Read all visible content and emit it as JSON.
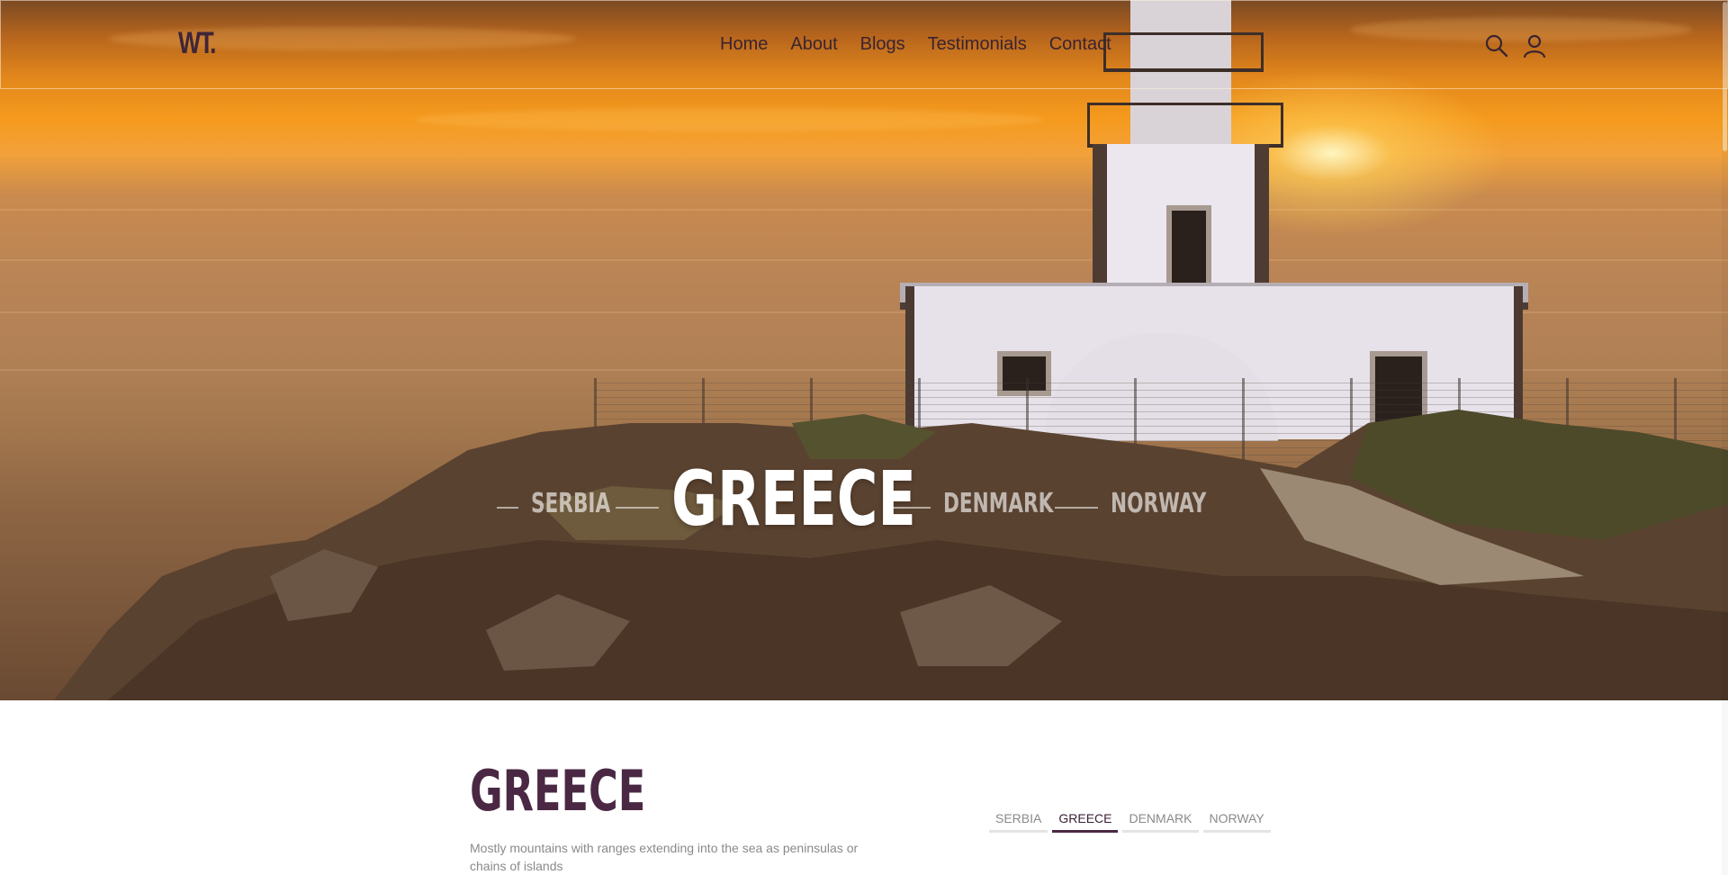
{
  "header": {
    "logo": "WT.",
    "nav": [
      "Home",
      "About",
      "Blogs",
      "Testimonials",
      "Contact"
    ],
    "icons": [
      "search-icon",
      "user-icon"
    ]
  },
  "hero": {
    "slides_left": [
      "SERBIA"
    ],
    "active": "GREECE",
    "slides_right": [
      "DENMARK",
      "NORWAY"
    ]
  },
  "content": {
    "title": "GREECE",
    "description": "Mostly mountains with ranges extending into the sea as peninsulas or chains of islands",
    "tabs": [
      "SERBIA",
      "GREECE",
      "DENMARK",
      "NORWAY"
    ],
    "active_tab": "GREECE"
  },
  "colors": {
    "brand": "#4a2843",
    "nav_text": "#3a2430",
    "muted": "#8a8a8a"
  }
}
